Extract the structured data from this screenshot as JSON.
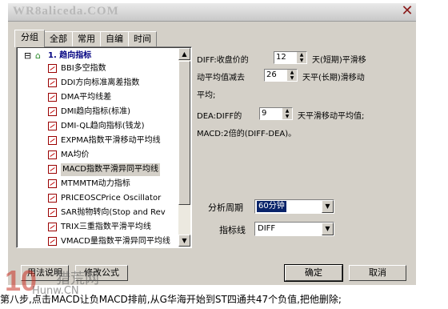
{
  "window": {
    "title": "WR8aliceda.COM",
    "close_glyph": "✕"
  },
  "tabs": [
    {
      "label": "分组"
    },
    {
      "label": "全部"
    },
    {
      "label": "常用"
    },
    {
      "label": "自编"
    },
    {
      "label": "时间"
    }
  ],
  "tree": {
    "group_label": "1. 趋向指标",
    "expander": "⊟",
    "items": [
      {
        "label": "BBI多空指数"
      },
      {
        "label": "DDI方向标准离差指数"
      },
      {
        "label": "DMA平均线差"
      },
      {
        "label": "DMI趋向指标(标准)"
      },
      {
        "label": "DMI-QL趋向指标(钱龙)"
      },
      {
        "label": "EXPMA指数平滑移动平均线"
      },
      {
        "label": "MA均价"
      },
      {
        "label": "MACD指数平滑异同平均线"
      },
      {
        "label": "MTMMTM动力指标"
      },
      {
        "label": "PRICEOSCPrice Oscillator"
      },
      {
        "label": "SAR抛物转向(Stop and Rev"
      },
      {
        "label": "TRIX三重指数平滑平均线"
      },
      {
        "label": "VMACD量指数平滑异同平均线"
      }
    ],
    "selected_index": 7
  },
  "params": {
    "line1_pre": "DIFF:收盘价的",
    "short_value": "12",
    "line1_post": "天(短期)平滑移",
    "line2_pre": "动平均值减去",
    "long_value": "26",
    "line2_post": "天平(长期)滑移动",
    "line3": "平均;",
    "dea_pre": "DEA:DIFF的",
    "dea_value": "9",
    "dea_post": "天平滑移动平均值;",
    "macd_line": "MACD:2倍的(DIFF-DEA)。"
  },
  "period": {
    "label": "分析周期",
    "value": "60分钟"
  },
  "indicator_line": {
    "label": "指标线",
    "value": "DIFF"
  },
  "buttons": {
    "usage": "用法说明",
    "edit_formula": "修改公式",
    "ok": "确定",
    "cancel": "取消"
  },
  "watermark": {
    "logo": "10",
    "name": "猎荒网",
    "url": "Hunw.CN"
  },
  "caption": "第八步,点击MACD让负MACD排前,从G华海开始到ST四通共47个负值,把他删除;"
}
